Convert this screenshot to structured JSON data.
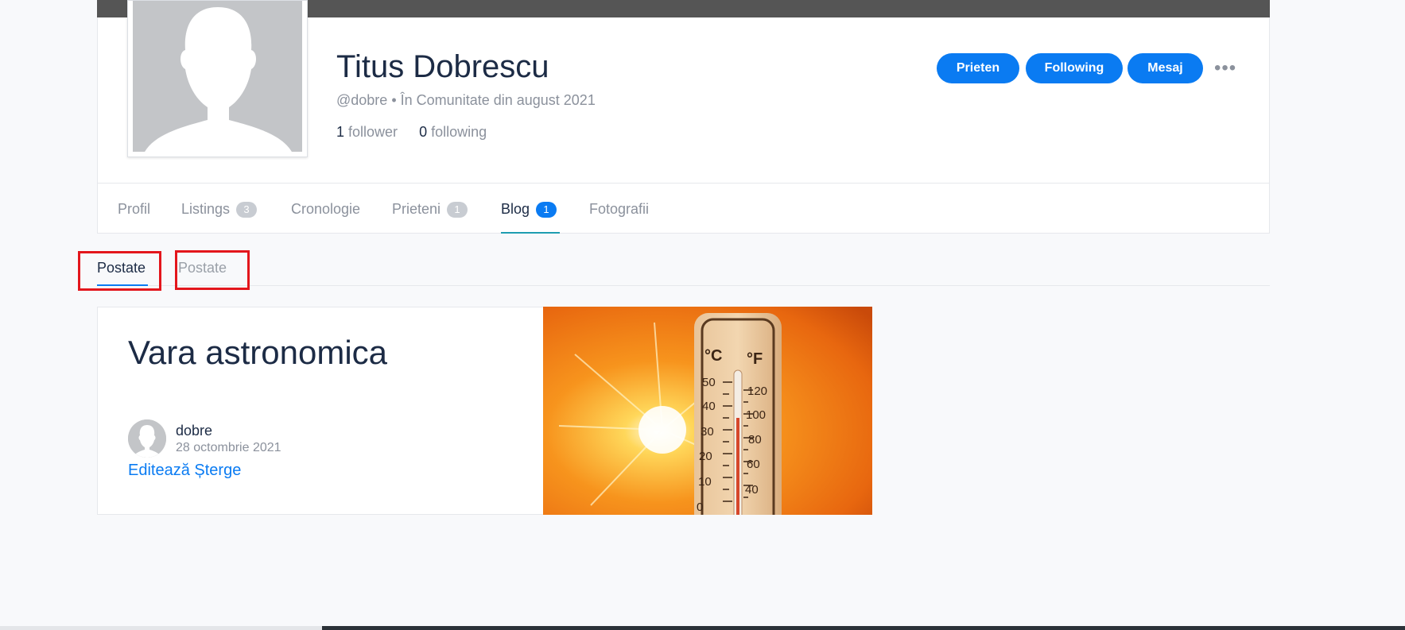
{
  "profile": {
    "name": "Titus Dobrescu",
    "handle": "@dobre",
    "separator": "•",
    "member_since": "În Comunitate din august 2021",
    "followers_count": "1",
    "followers_label": "follower",
    "following_count": "0",
    "following_label": "following"
  },
  "actions": {
    "friend_label": "Prieten",
    "following_label": "Following",
    "message_label": "Mesaj",
    "more_label": "•••"
  },
  "nav": {
    "tabs": [
      {
        "label": "Profil"
      },
      {
        "label": "Listings",
        "count": "3"
      },
      {
        "label": "Cronologie"
      },
      {
        "label": "Prieteni",
        "count": "1"
      },
      {
        "label": "Blog",
        "count": "1"
      },
      {
        "label": "Fotografii"
      }
    ],
    "active": "Blog"
  },
  "subtabs": [
    {
      "label": "Postate",
      "active": true
    },
    {
      "label": "Postate",
      "active": false
    }
  ],
  "post": {
    "title": "Vara astronomica",
    "author": "dobre",
    "date": "28 octombrie 2021",
    "edit_label": "Editează",
    "delete_label": "Șterge",
    "thermometer": {
      "celsius_unit": "°C",
      "fahrenheit_unit": "°F",
      "celsius_ticks": [
        "50",
        "40",
        "30",
        "20",
        "10",
        "0"
      ],
      "fahrenheit_ticks": [
        "120",
        "100",
        "80",
        "60",
        "40"
      ]
    }
  },
  "colors": {
    "accent": "#0a7bf2",
    "cover": "#555555",
    "highlight": "#e3161c",
    "tab_underline": "#1e9db0"
  }
}
